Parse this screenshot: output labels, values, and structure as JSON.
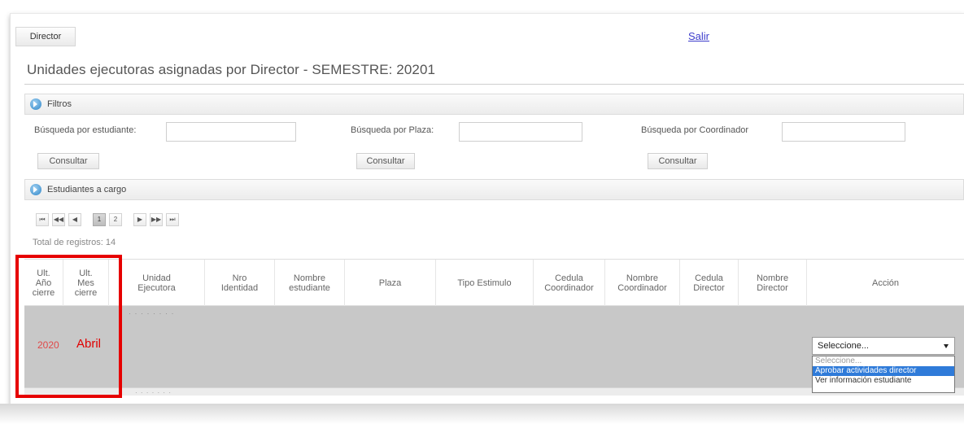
{
  "nav": {
    "tab_label": "Director",
    "logout_label": "Salir"
  },
  "page_title": "Unidades ejecutoras asignadas por Director - SEMESTRE: 20201",
  "filters": {
    "header": "Filtros",
    "student": {
      "label": "Búsqueda por estudiante:",
      "value": "",
      "button": "Consultar"
    },
    "plaza": {
      "label": "Búsqueda por Plaza:",
      "value": "",
      "button": "Consultar"
    },
    "coordinator": {
      "label": "Búsqueda por Coordinador",
      "value": "",
      "button": "Consultar"
    }
  },
  "students_panel": {
    "header": "Estudiantes a cargo",
    "pager": {
      "buttons": [
        "⏮",
        "◀◀",
        "◀",
        "1",
        "2",
        "▶",
        "▶▶",
        "⏭"
      ],
      "current_page": "1"
    },
    "total_label": "Total de registros: 14"
  },
  "table": {
    "columns": [
      "Ult.\nAño\ncierre",
      "Ult.\nMes\ncierre",
      "Unidad\nEjecutora",
      "Nro\nIdentidad",
      "Nombre\nestudiante",
      "Plaza",
      "Tipo Estimulo",
      "Cedula\nCoordinador",
      "Nombre\nCoordinador",
      "Cedula\nDirector",
      "Nombre\nDirector",
      "Acción"
    ],
    "row": {
      "year": "2020",
      "month": "Abril"
    }
  },
  "action_select": {
    "selected": "Seleccione...",
    "options": [
      "Seleccione...",
      "Aprobar actividades director",
      "Ver información estudiante"
    ],
    "highlighted_option": "Aprobar actividades director"
  },
  "colors": {
    "highlight": "#e60000",
    "accent": "#2f7bd9",
    "link": "#3d3dcc"
  }
}
